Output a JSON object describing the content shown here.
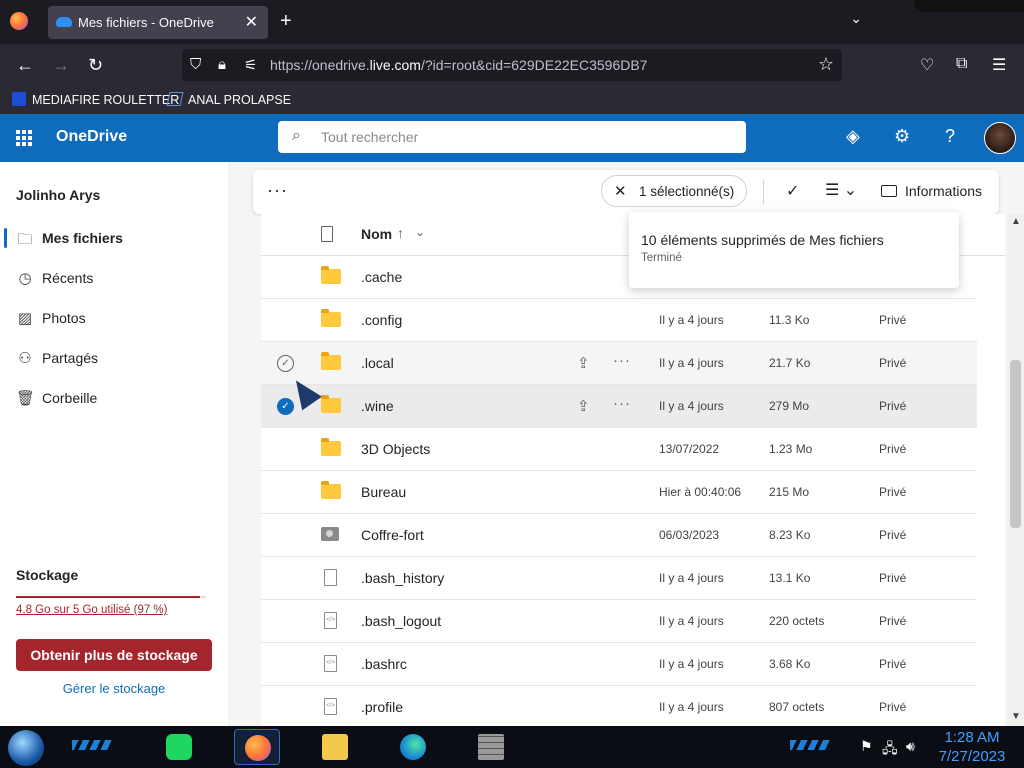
{
  "browser": {
    "tab_title": "Mes fichiers - OneDrive",
    "url_prefix": "https://onedrive.",
    "url_domain": "live.com",
    "url_suffix": "/?id=root&cid=629DE22EC3596DB7",
    "bookmarks": [
      {
        "label": "MEDIAFIRE ROULETTER"
      },
      {
        "label": "ANAL PROLAPSE"
      }
    ]
  },
  "header": {
    "app_name": "OneDrive",
    "search_placeholder": "Tout rechercher"
  },
  "sidebar": {
    "user_name": "Jolinho Arys",
    "items": [
      {
        "label": "Mes fichiers",
        "icon": "folder-icon",
        "active": true
      },
      {
        "label": "Récents",
        "icon": "clock-icon"
      },
      {
        "label": "Photos",
        "icon": "photo-icon"
      },
      {
        "label": "Partagés",
        "icon": "people-icon"
      },
      {
        "label": "Corbeille",
        "icon": "trash-icon"
      }
    ],
    "storage_title": "Stockage",
    "storage_text": "4,8 Go sur 5 Go utilisé (97 %)",
    "storage_fraction": 0.97,
    "get_storage_label": "Obtenir plus de stockage",
    "manage_storage_label": "Gérer le stockage"
  },
  "commandbar": {
    "selected_label": "1 sélectionné(s)",
    "info_label": "Informations"
  },
  "list": {
    "column_name": "Nom",
    "rows": [
      {
        "name": ".cache",
        "type": "folder",
        "date": "",
        "size": "",
        "sharing": ""
      },
      {
        "name": ".config",
        "type": "folder",
        "date": "Il y a 4 jours",
        "size": "11.3 Ko",
        "sharing": "Privé"
      },
      {
        "name": ".local",
        "type": "folder",
        "date": "Il y a 4 jours",
        "size": "21.7 Ko",
        "sharing": "Privé",
        "state": "hover"
      },
      {
        "name": ".wine",
        "type": "folder",
        "date": "Il y a 4 jours",
        "size": "279 Mo",
        "sharing": "Privé",
        "state": "selected"
      },
      {
        "name": "3D Objects",
        "type": "folder",
        "date": "13/07/2022",
        "size": "1.23 Mo",
        "sharing": "Privé"
      },
      {
        "name": "Bureau",
        "type": "folder",
        "date": "Hier à 00:40:06",
        "size": "215 Mo",
        "sharing": "Privé"
      },
      {
        "name": "Coffre-fort",
        "type": "vault",
        "date": "06/03/2023",
        "size": "8.23 Ko",
        "sharing": "Privé"
      },
      {
        "name": ".bash_history",
        "type": "file",
        "date": "Il y a 4 jours",
        "size": "13.1 Ko",
        "sharing": "Privé"
      },
      {
        "name": ".bash_logout",
        "type": "code",
        "date": "Il y a 4 jours",
        "size": "220 octets",
        "sharing": "Privé"
      },
      {
        "name": ".bashrc",
        "type": "code",
        "date": "Il y a 4 jours",
        "size": "3.68 Ko",
        "sharing": "Privé"
      },
      {
        "name": ".profile",
        "type": "code",
        "date": "Il y a 4 jours",
        "size": "807 octets",
        "sharing": "Privé"
      }
    ]
  },
  "toast": {
    "title": "10 éléments supprimés de Mes fichiers",
    "status": "Terminé"
  },
  "taskbar": {
    "time": "1:28 AM",
    "date": "7/27/2023"
  },
  "colors": {
    "brand": "#0f6cbd",
    "danger": "#a4262c"
  }
}
